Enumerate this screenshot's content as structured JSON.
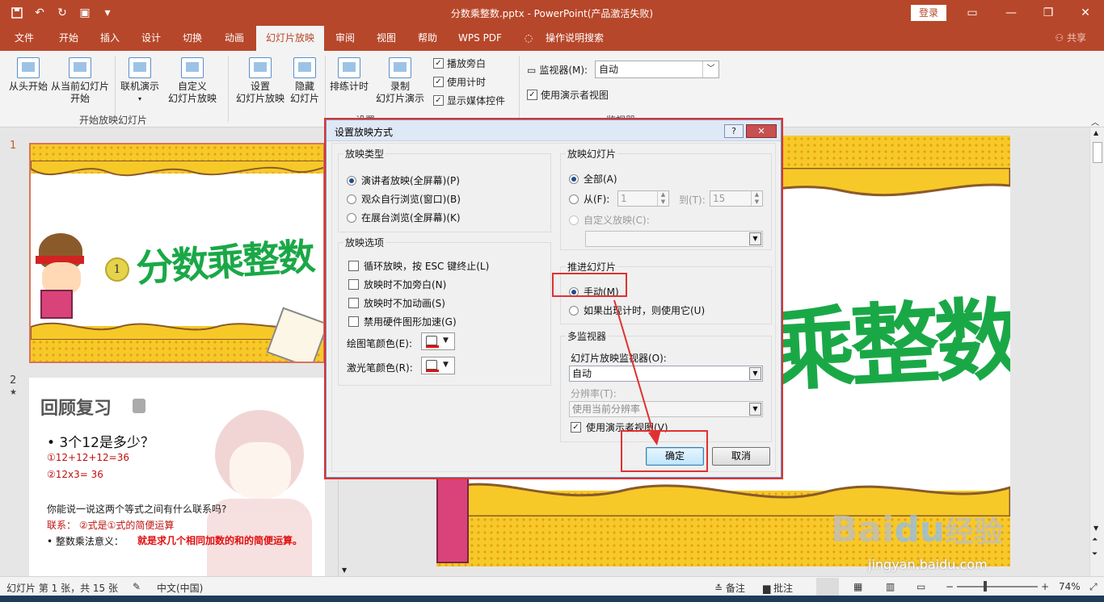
{
  "titlebar": {
    "title": "分数乘整数.pptx  -  PowerPoint(产品激活失败)",
    "login": "登录",
    "qat_icons": [
      "save-icon",
      "undo-icon",
      "redo-icon",
      "present-icon",
      "customize-icon"
    ]
  },
  "tabs": [
    "文件",
    "开始",
    "插入",
    "设计",
    "切换",
    "动画",
    "幻灯片放映",
    "审阅",
    "视图",
    "帮助",
    "WPS PDF",
    "操作说明搜索"
  ],
  "share": "共享",
  "ribbon": {
    "btn_from_start": "从头开始",
    "btn_from_current_1": "从当前幻灯片",
    "btn_from_current_2": "开始",
    "btn_online": "联机演示",
    "btn_custom_1": "自定义",
    "btn_custom_2": "幻灯片放映",
    "group1": "开始放映幻灯片",
    "btn_setup_1": "设置",
    "btn_setup_2": "幻灯片放映",
    "btn_hide_1": "隐藏",
    "btn_hide_2": "幻灯片",
    "btn_rehearse": "排练计时",
    "btn_record_1": "录制",
    "btn_record_2": "幻灯片演示",
    "chk_narration": "播放旁白",
    "chk_timing": "使用计时",
    "chk_media": "显示媒体控件",
    "group2": "设置",
    "monitor_label": "监视器(M):",
    "monitor_value": "自动",
    "chk_presenter": "使用演示者视图",
    "group3": "监视器"
  },
  "slides": {
    "n1": "1",
    "n2": "2",
    "star": "★",
    "s1_title": "分数乘整数",
    "s1_badge": "1",
    "s2_title": "回顾复习",
    "s2_q": "• 3个12是多少？",
    "s2_a1": "①12+12+12=36",
    "s2_a2": "②12x3= 36",
    "s2_q2": "你能说一说这两个等式之间有什么联系吗?",
    "s2_link": "联系：  ②式是①式的简便运算",
    "s2_meaning_label": "•  整数乘法意义：",
    "s2_meaning": "就是求几个相同加数的和的简便运算。"
  },
  "main_slide": {
    "title": "乘整数"
  },
  "dialog": {
    "title": "设置放映方式",
    "help": "?",
    "close": "✕",
    "type_legend": "放映类型",
    "type_opts": [
      "演讲者放映(全屏幕)(P)",
      "观众自行浏览(窗口)(B)",
      "在展台浏览(全屏幕)(K)"
    ],
    "options_legend": "放映选项",
    "options": [
      "循环放映，按 ESC 键终止(L)",
      "放映时不加旁白(N)",
      "放映时不加动画(S)",
      "禁用硬件图形加速(G)"
    ],
    "pen_color": "绘图笔颜色(E):",
    "laser_color": "激光笔颜色(R):",
    "slides_legend": "放映幻灯片",
    "all": "全部(A)",
    "from": "从(F):",
    "from_value": "1",
    "to": "到(T):",
    "to_value": "15",
    "custom_show": "自定义放映(C):",
    "advance_legend": "推进幻灯片",
    "manual": "手动(M)",
    "use_timing": "如果出现计时，则使用它(U)",
    "multi_legend": "多监视器",
    "monitor_label": "幻灯片放映监视器(O):",
    "monitor_value": "自动",
    "resolution_label": "分辨率(T):",
    "resolution_value": "使用当前分辨率",
    "presenter_view": "使用演示者视图(V)",
    "ok": "确定",
    "cancel": "取消"
  },
  "statusbar": {
    "slide_info": "幻灯片 第 1 张，共 15 张",
    "language": "中文(中国)",
    "notes": "备注",
    "comments": "批注",
    "zoom_minus": "−",
    "zoom_plus": "+",
    "zoom": "74%"
  },
  "watermark": {
    "brand": "Bai",
    "brand2": "du",
    "jy": "经验",
    "url": "jingyan.baidu.com"
  },
  "colors": {
    "accent": "#b7472a",
    "highlight": "#e03131",
    "green_text": "#1aa847"
  }
}
